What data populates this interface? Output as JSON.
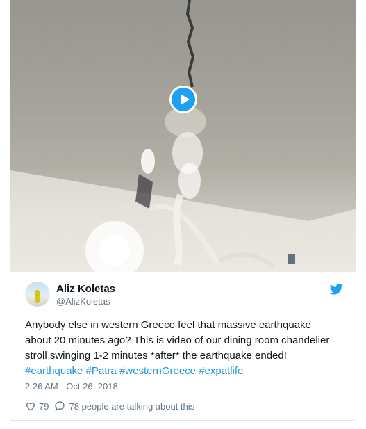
{
  "tweet": {
    "author_name": "Aliz Koletas",
    "author_handle": "@AlizKoletas",
    "text_parts": {
      "t1": "Anybody else in western Greece feel that massive earthquake about 20 minutes ago? This is video of our dining room chandelier stroll swinging 1-2 minutes *after* the earthquake ended! ",
      "h1": "#earthquake",
      "h2": "#Patra",
      "h3": "#westernGreece",
      "h4": "#expatlife"
    },
    "timestamp": "2:26 AM - Oct 26, 2018",
    "likes": "79",
    "replies_text": "78 people are talking about this"
  },
  "colors": {
    "accent": "#1da1f2",
    "hashtag": "#1b95e0",
    "secondary_text": "#657786"
  },
  "icons": {
    "play": "play-icon",
    "bird": "twitter-bird-icon",
    "like": "heart-icon",
    "reply": "speech-bubble-icon"
  }
}
